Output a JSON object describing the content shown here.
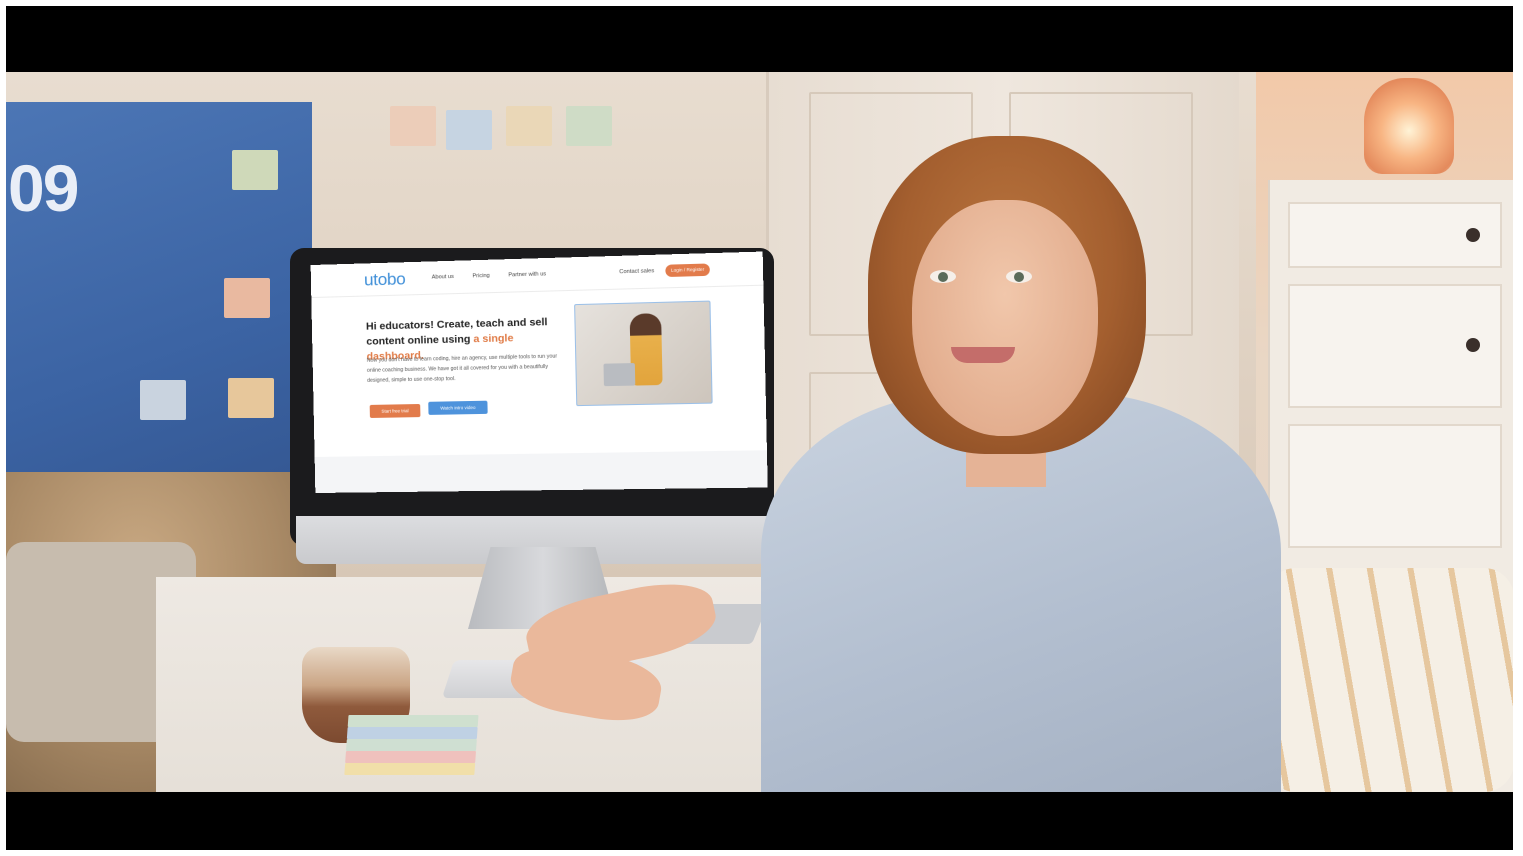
{
  "background": "video still: woman at a desk in front of an iMac showing a web page",
  "wall_board": {
    "text": "09"
  },
  "screen": {
    "logo": "utobo",
    "nav": {
      "about": "About us",
      "pricing": "Pricing",
      "partner": "Partner with us",
      "contact": "Contact sales",
      "login": "Login / Register"
    },
    "hero": {
      "title_main": "Hi educators! Create, teach and sell content online using ",
      "title_accent": "a single dashboard.",
      "body": "Now you don't have to learn coding, hire an agency, use multiple tools to run your online coaching business. We have got it all covered for you with a beautifully designed, simple to use one-stop tool.",
      "start_trial": "Start free trial",
      "watch_video": "Watch intro video"
    }
  },
  "colors": {
    "logo_blue": "#3f8fd8",
    "accent_orange": "#e27b4b",
    "button_blue": "#4e93dc"
  }
}
